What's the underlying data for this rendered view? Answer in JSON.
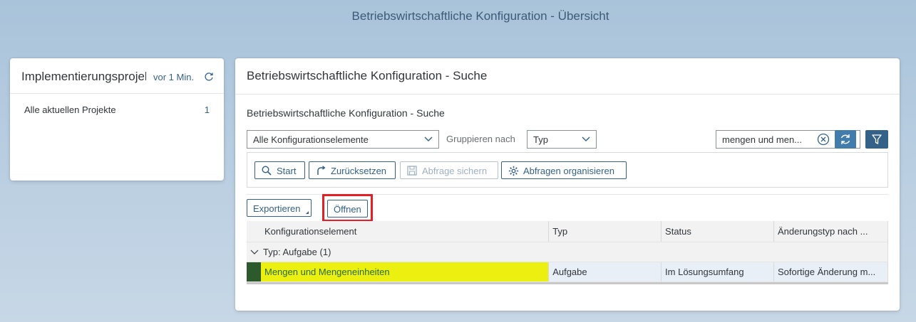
{
  "shell": {
    "title": "Betriebswirtschaftliche Konfiguration - Übersicht"
  },
  "tile": {
    "title": "Implementierungsprojekte",
    "time": "vor 1 Min.",
    "row_label": "Alle aktuellen Projekte",
    "row_count": "1"
  },
  "main": {
    "title": "Betriebswirtschaftliche Konfiguration - Suche",
    "subtitle": "Betriebswirtschaftliche Konfiguration - Suche",
    "filter_select": "Alle Konfigurationselemente",
    "group_label": "Gruppieren nach",
    "group_select": "Typ",
    "search_value": "mengen und men...",
    "buttons": {
      "start": "Start",
      "reset": "Zurücksetzen",
      "save_query": "Abfrage sichern",
      "organize": "Abfragen organisieren",
      "export": "Exportieren",
      "open": "Öffnen"
    },
    "table": {
      "columns": [
        "Konfigurationselement",
        "Typ",
        "Status",
        "Änderungstyp nach ..."
      ],
      "group": "Typ: Aufgabe (1)",
      "rows": [
        {
          "element": "Mengen und Mengeneinheiten",
          "type": "Aufgabe",
          "status": "Im Lösungsumfang",
          "change": "Sofortige Änderung m..."
        }
      ]
    }
  },
  "colors": {
    "accent": "#346187",
    "highlight": "#ebf010",
    "annotation": "#e31e24"
  }
}
